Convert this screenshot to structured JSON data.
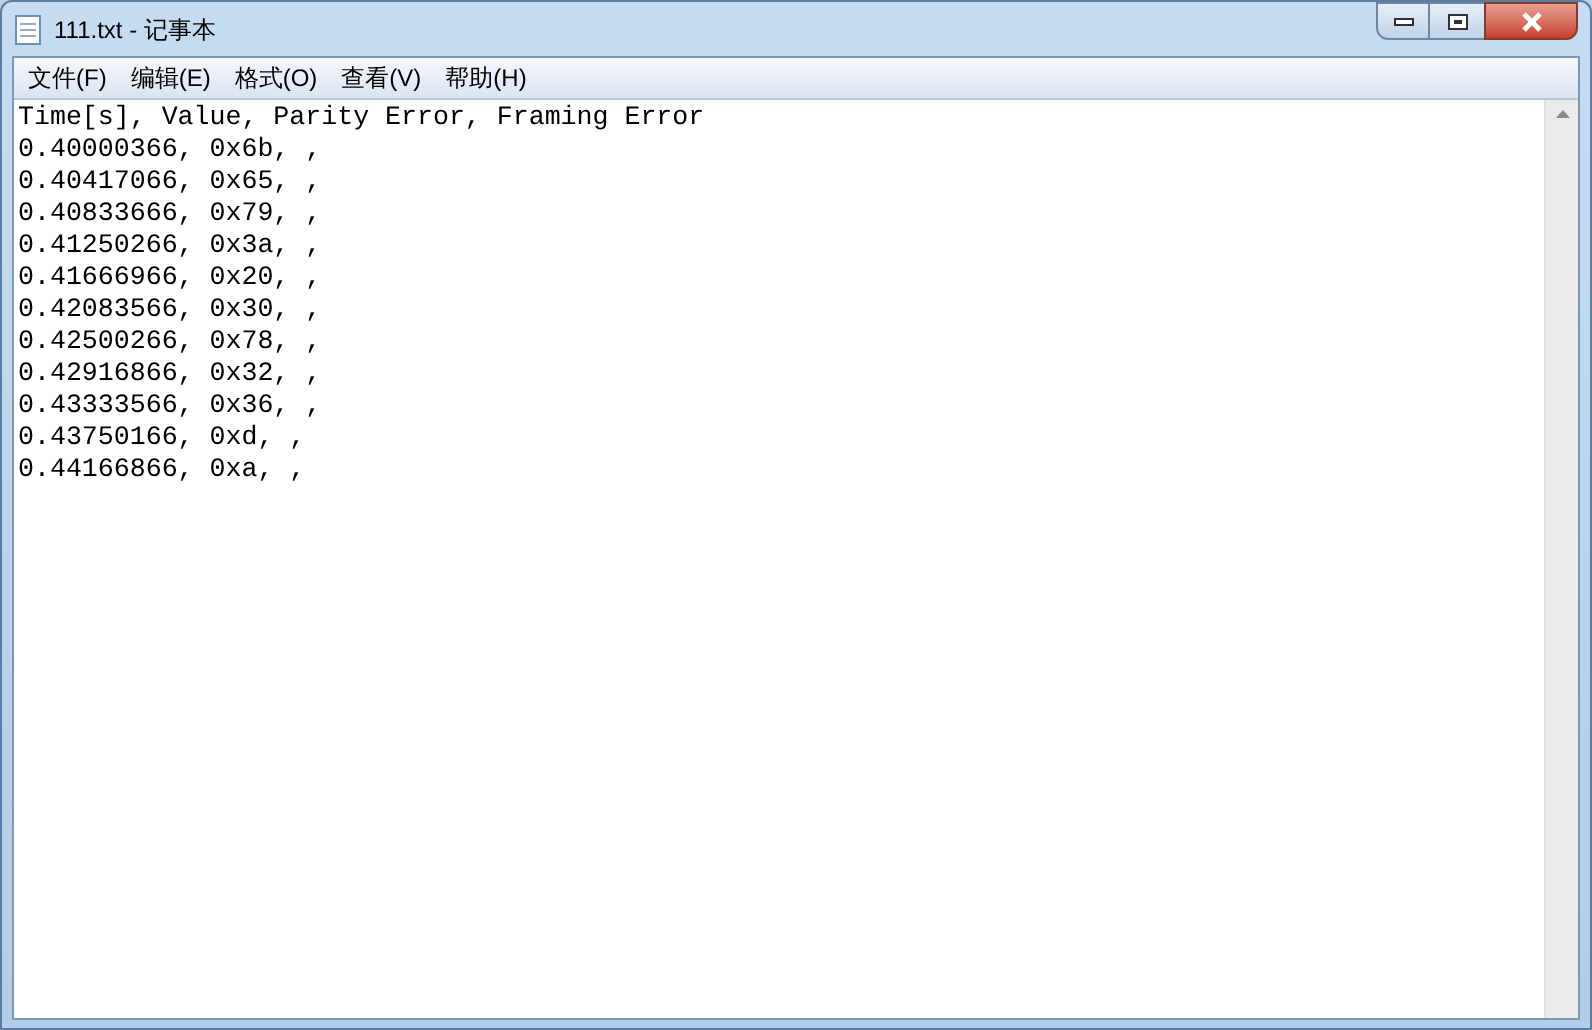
{
  "window": {
    "title": "111.txt - 记事本"
  },
  "menu": [
    "文件(F)",
    "编辑(E)",
    "格式(O)",
    "查看(V)",
    "帮助(H)"
  ],
  "lines": [
    "Time[s], Value, Parity Error, Framing Error",
    "0.40000366, 0x6b, ,",
    "0.40417066, 0x65, ,",
    "0.40833666, 0x79, ,",
    "0.41250266, 0x3a, ,",
    "0.41666966, 0x20, ,",
    "0.42083566, 0x30, ,",
    "0.42500266, 0x78, ,",
    "0.42916866, 0x32, ,",
    "0.43333566, 0x36, ,",
    "0.43750166, 0xd, ,",
    "0.44166866, 0xa, ,"
  ]
}
